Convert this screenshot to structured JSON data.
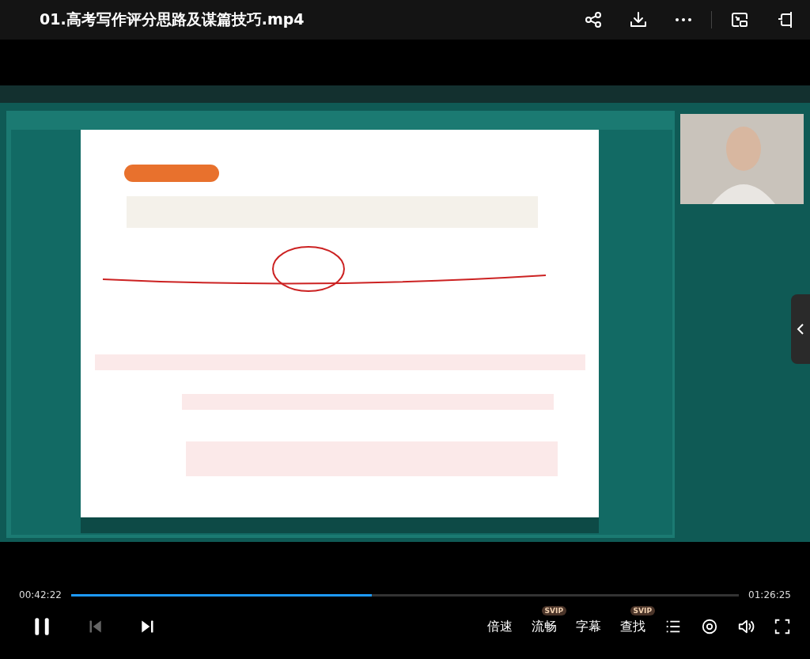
{
  "window": {
    "title": "01.高考写作评分思路及谋篇技巧.mp4"
  },
  "toolbar": [
    {
      "kind": "share"
    },
    {
      "kind": "download"
    },
    {
      "kind": "more"
    },
    {
      "kind": "pip"
    },
    {
      "kind": "dock"
    }
  ],
  "side_panel": {
    "expanded": false
  },
  "playback": {
    "current_time": "00:42:22",
    "duration": "01:26:25",
    "level": 0.45,
    "playing": true
  },
  "controls": [
    {
      "kind": "pause",
      "disabled": false
    },
    {
      "kind": "previous",
      "disabled": true
    },
    {
      "kind": "next",
      "disabled": false
    }
  ],
  "options": [
    {
      "label": "倍速"
    },
    {
      "label": "流畅",
      "badge": "SVIP"
    },
    {
      "label": "字幕"
    },
    {
      "label": "查找",
      "badge": "SVIP"
    }
  ],
  "right_icons": [
    {
      "kind": "list"
    },
    {
      "kind": "eye"
    },
    {
      "kind": "volume"
    },
    {
      "kind": "fullscreen"
    }
  ]
}
